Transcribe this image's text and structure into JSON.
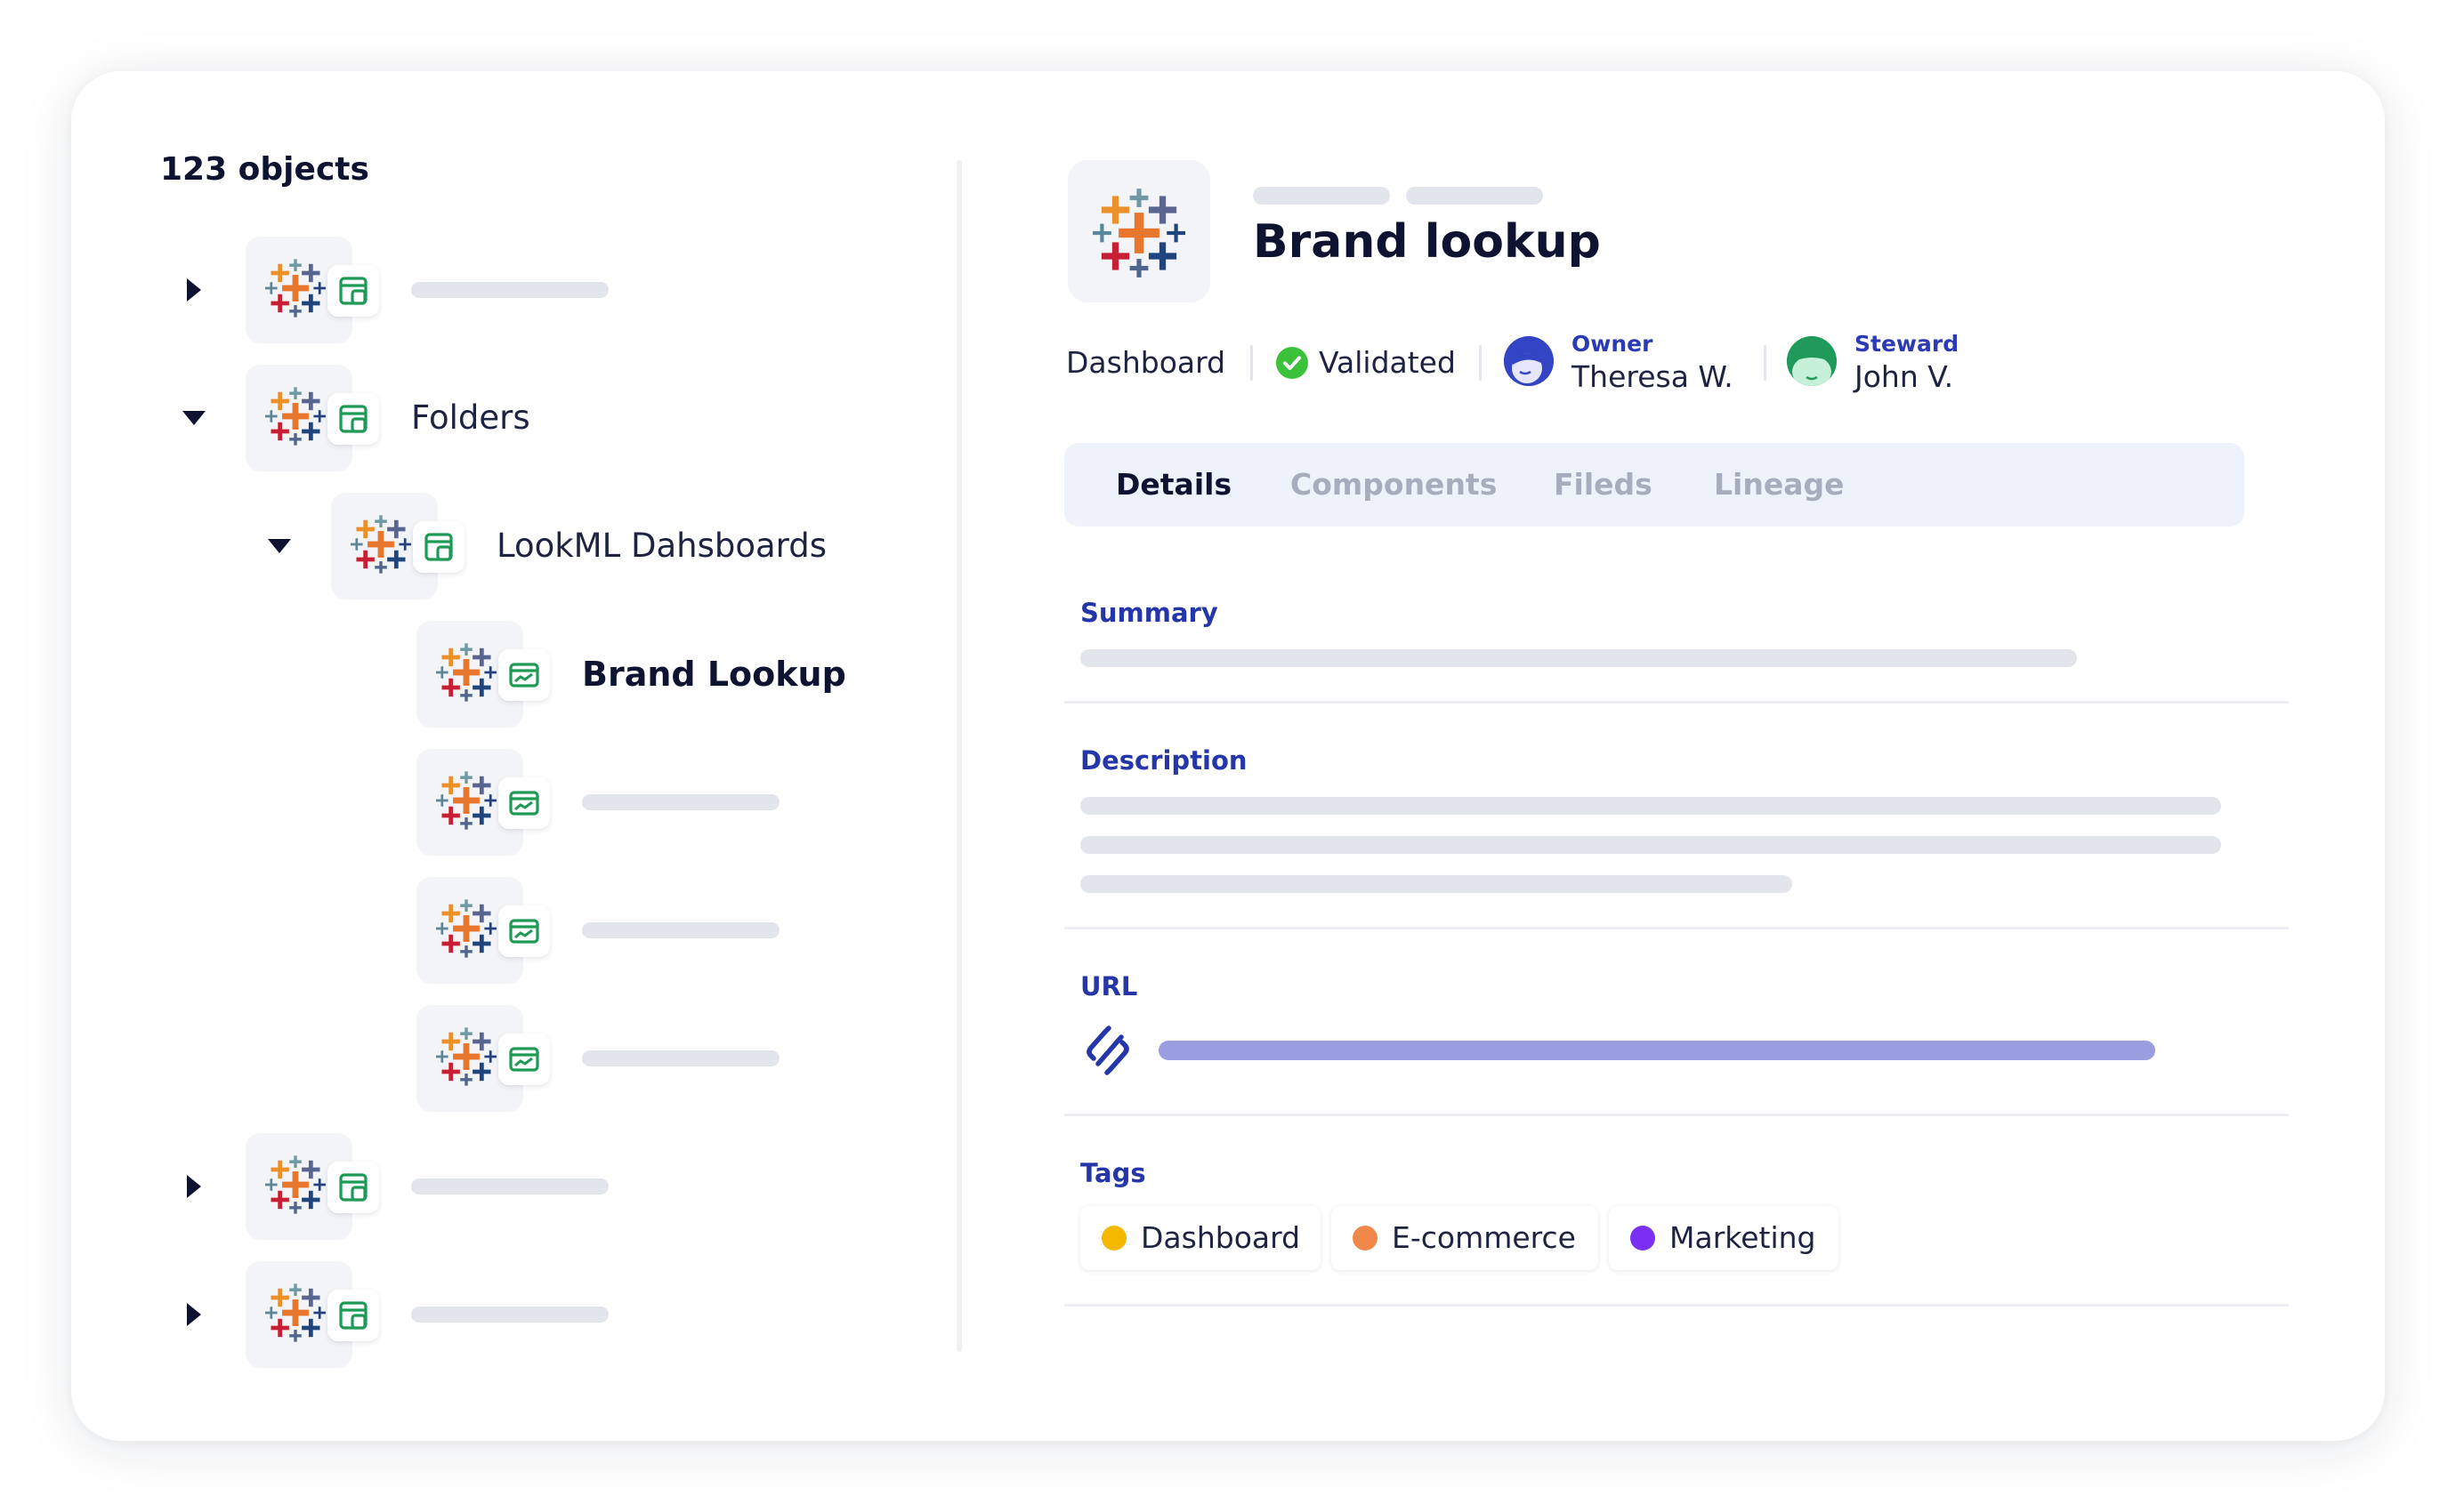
{
  "sidebar": {
    "count_label": "123 objects",
    "items": [
      {
        "label": "",
        "expanded": false,
        "badge": "folder-icon"
      },
      {
        "label": "Folders",
        "expanded": true,
        "badge": "folder-icon"
      },
      {
        "label": "LookML Dahsboards",
        "expanded": true,
        "badge": "folder-icon"
      },
      {
        "label": "Brand Lookup",
        "selected": true,
        "badge": "dashboard-icon"
      },
      {
        "label": "",
        "badge": "dashboard-icon"
      },
      {
        "label": "",
        "badge": "dashboard-icon"
      },
      {
        "label": "",
        "badge": "dashboard-icon"
      },
      {
        "label": "",
        "expanded": false,
        "badge": "folder-icon"
      },
      {
        "label": "",
        "expanded": false,
        "badge": "folder-icon"
      }
    ]
  },
  "detail": {
    "title": "Brand lookup",
    "type_label": "Dashboard",
    "status_label": "Validated",
    "owner": {
      "role": "Owner",
      "name": "Theresa W."
    },
    "steward": {
      "role": "Steward",
      "name": "John V."
    },
    "tabs": [
      {
        "label": "Details",
        "active": true
      },
      {
        "label": "Components",
        "active": false
      },
      {
        "label": "Fileds",
        "active": false
      },
      {
        "label": "Lineage",
        "active": false
      }
    ],
    "sections": {
      "summary": "Summary",
      "description": "Description",
      "url": "URL",
      "tags": "Tags"
    },
    "tags": [
      {
        "label": "Dashboard",
        "color": "#f5b800"
      },
      {
        "label": "E-commerce",
        "color": "#f0884a"
      },
      {
        "label": "Marketing",
        "color": "#7b2ff2"
      }
    ]
  },
  "colors": {
    "accent": "#2536a8",
    "validated": "#3cc13b",
    "url_bar": "#9a9ddf",
    "owner_avatar": "#3344c4",
    "steward_avatar": "#1f9a5a"
  }
}
